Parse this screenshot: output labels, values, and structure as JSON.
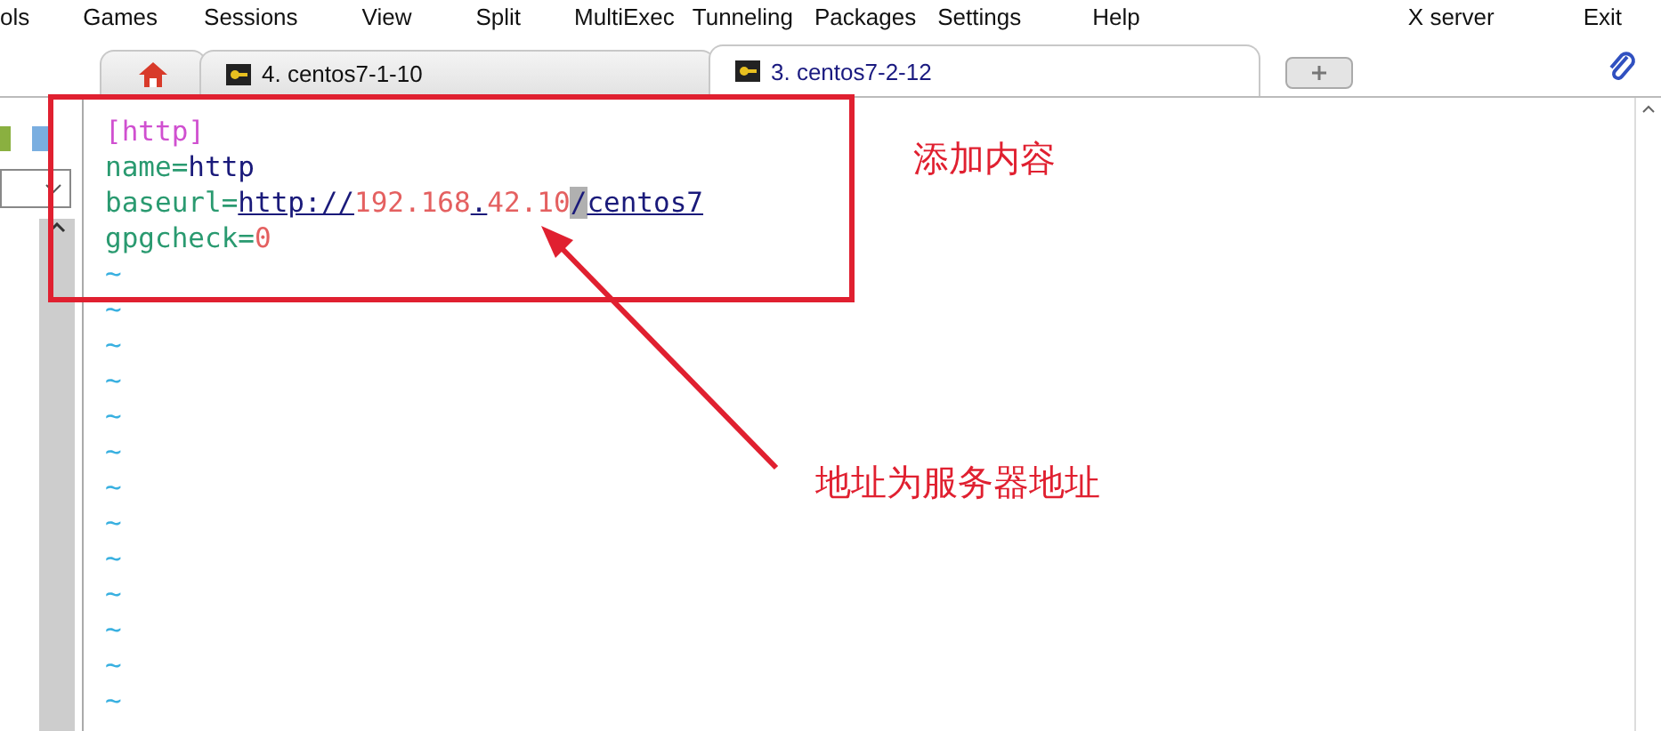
{
  "menu": [
    "ols",
    "Games",
    "Sessions",
    "View",
    "Split",
    "MultiExec",
    "Tunneling",
    "Packages",
    "Settings",
    "Help"
  ],
  "menu_right": [
    "X server",
    "Exit"
  ],
  "tabs": [
    {
      "label": "4. centos7-1-10",
      "selected": false
    },
    {
      "label": "3. centos7-2-12",
      "selected": true
    }
  ],
  "terminal": {
    "lines": [
      [
        {
          "text": "[http]",
          "kind": "section"
        }
      ],
      [
        {
          "text": "name",
          "kind": "key"
        },
        {
          "text": "=",
          "kind": "op"
        },
        {
          "text": "http",
          "kind": "value"
        }
      ],
      [
        {
          "text": "baseurl",
          "kind": "key"
        },
        {
          "text": "=",
          "kind": "op"
        },
        {
          "text": "http://",
          "kind": "url"
        },
        {
          "text": "192.168",
          "kind": "number"
        },
        {
          "text": ".",
          "kind": "url"
        },
        {
          "text": "42.10",
          "kind": "number"
        },
        {
          "text": "/",
          "kind": "cursor"
        },
        {
          "text": "centos7",
          "kind": "url"
        }
      ],
      [
        {
          "text": "gpgcheck",
          "kind": "key"
        },
        {
          "text": "=",
          "kind": "op"
        },
        {
          "text": "0",
          "kind": "number"
        }
      ],
      [
        {
          "text": "~",
          "kind": "empty"
        }
      ],
      [
        {
          "text": "~",
          "kind": "empty"
        }
      ],
      [
        {
          "text": "~",
          "kind": "empty"
        }
      ],
      [
        {
          "text": "~",
          "kind": "empty"
        }
      ],
      [
        {
          "text": "~",
          "kind": "empty"
        }
      ],
      [
        {
          "text": "~",
          "kind": "empty"
        }
      ],
      [
        {
          "text": "~",
          "kind": "empty"
        }
      ],
      [
        {
          "text": "~",
          "kind": "empty"
        }
      ],
      [
        {
          "text": "~",
          "kind": "empty"
        }
      ],
      [
        {
          "text": "~",
          "kind": "empty"
        }
      ],
      [
        {
          "text": "~",
          "kind": "empty"
        }
      ],
      [
        {
          "text": "~",
          "kind": "empty"
        }
      ],
      [
        {
          "text": "~",
          "kind": "empty"
        }
      ]
    ]
  },
  "annotations": [
    {
      "text": "添加内容"
    },
    {
      "text": "地址为服务器地址"
    }
  ]
}
